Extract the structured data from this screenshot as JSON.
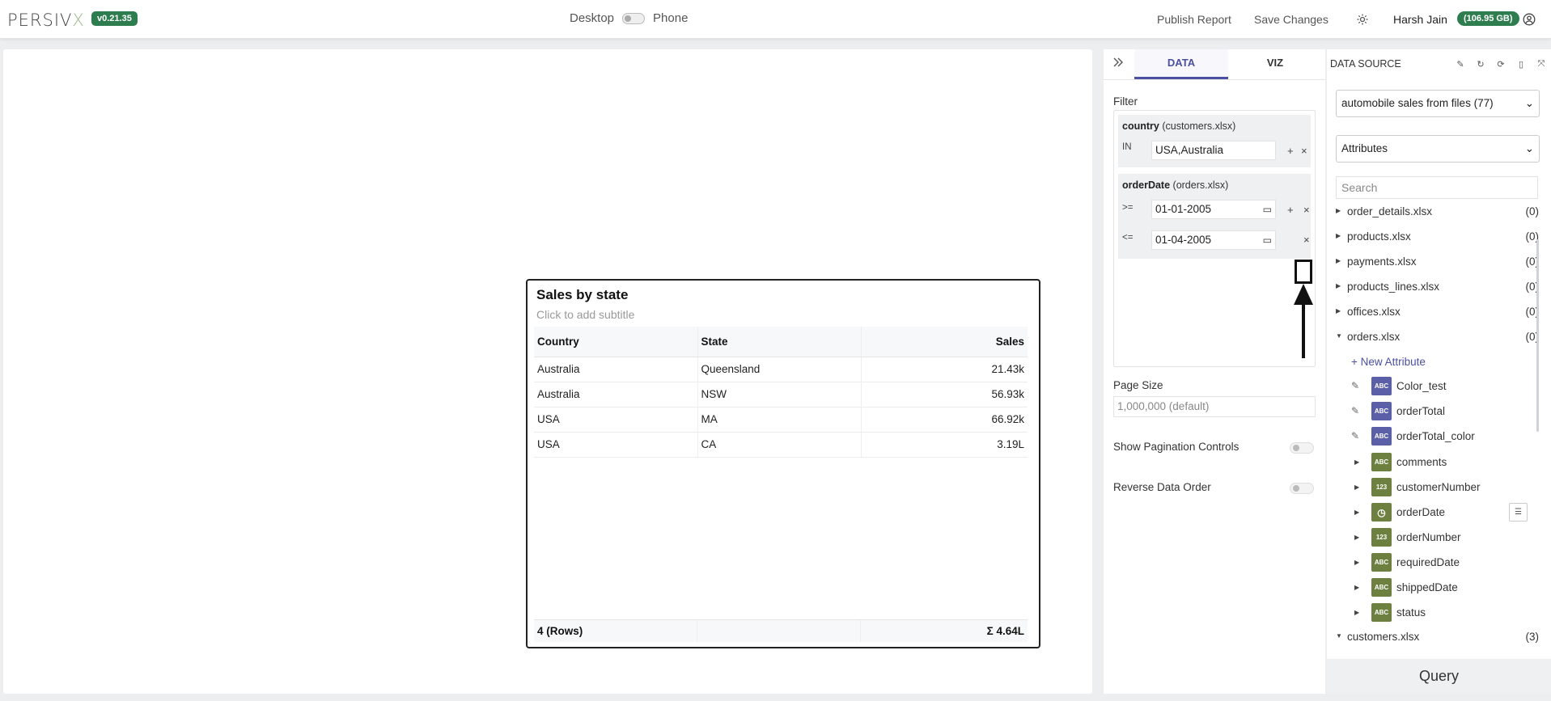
{
  "header": {
    "logo_main": "PERSIV",
    "logo_x": "X",
    "version": "v0.21.35",
    "device_desktop": "Desktop",
    "device_phone": "Phone",
    "publish_label": "Publish Report",
    "save_label": "Save Changes",
    "user_name": "Harsh Jain",
    "storage": "(106.95 GB)"
  },
  "widget": {
    "title": "Sales by state",
    "subtitle": "Click to add subtitle",
    "columns": [
      "Country",
      "State",
      "Sales"
    ],
    "rows": [
      [
        "Australia",
        "Queensland",
        "21.43k"
      ],
      [
        "Australia",
        "NSW",
        "56.93k"
      ],
      [
        "USA",
        "MA",
        "66.92k"
      ],
      [
        "USA",
        "CA",
        "3.19L"
      ]
    ],
    "footer_rows": "4 (Rows)",
    "footer_total": "Σ 4.64L"
  },
  "config": {
    "tabs": [
      "DATA",
      "VIZ"
    ],
    "filter_label": "Filter",
    "filter1": {
      "field": "country",
      "source": "(customers.xlsx)",
      "op": "IN",
      "value": "USA,Australia"
    },
    "filter2": {
      "field": "orderDate",
      "source": "(orders.xlsx)",
      "op1": ">=",
      "value1": "01-01-2005",
      "op2": "<=",
      "value2": "01-04-2005"
    },
    "add_symbol": "+",
    "remove_symbol": "×",
    "page_size_label": "Page Size",
    "page_size_value": "1,000,000 (default)",
    "pagination_label": "Show Pagination Controls",
    "reverse_label": "Reverse Data Order"
  },
  "datasource": {
    "title": "DATA SOURCE",
    "selected_source": "automobile sales from files (77)",
    "selected_view": "Attributes",
    "search_placeholder": "Search",
    "tables": [
      {
        "name": "order_details.xlsx",
        "count": "(0)"
      },
      {
        "name": "products.xlsx",
        "count": "(0)"
      },
      {
        "name": "payments.xlsx",
        "count": "(0)"
      },
      {
        "name": "products_lines.xlsx",
        "count": "(0)"
      },
      {
        "name": "offices.xlsx",
        "count": "(0)"
      },
      {
        "name": "orders.xlsx",
        "count": "(0)"
      }
    ],
    "new_attribute": "New Attribute",
    "attributes": [
      {
        "badge": "ABC",
        "name": "Color_test"
      },
      {
        "badge": "ABC",
        "name": "orderTotal"
      },
      {
        "badge": "ABC",
        "name": "orderTotal_color"
      },
      {
        "badge": "ABC",
        "name": "comments"
      },
      {
        "badge": "123",
        "name": "customerNumber"
      },
      {
        "badge": "◷",
        "name": "orderDate"
      },
      {
        "badge": "123",
        "name": "orderNumber"
      },
      {
        "badge": "ABC",
        "name": "requiredDate"
      },
      {
        "badge": "ABC",
        "name": "shippedDate"
      },
      {
        "badge": "ABC",
        "name": "status"
      }
    ],
    "customers": {
      "name": "customers.xlsx",
      "count": "(3)"
    },
    "query_label": "Query"
  },
  "colors": {
    "accent": "#4b4fa3",
    "badge_green": "#2e7d4f",
    "attr_custom": "#5b5fa8",
    "attr_native": "#6e8040"
  }
}
